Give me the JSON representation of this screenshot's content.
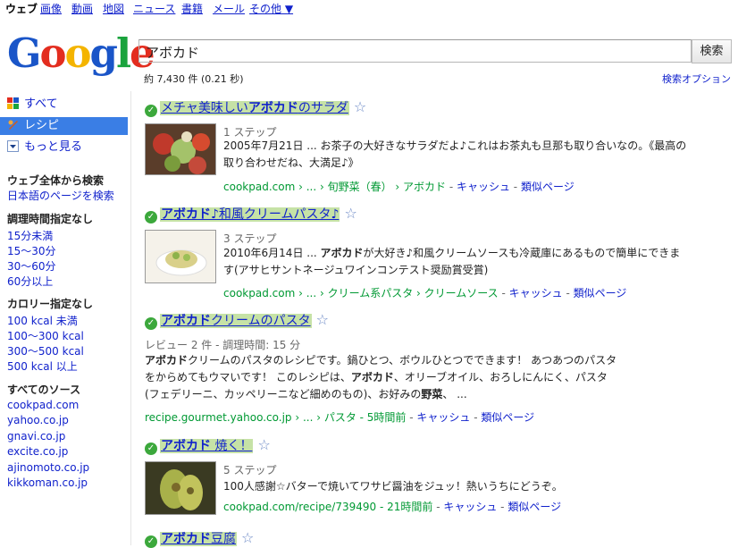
{
  "topnav": {
    "items": [
      "ウェブ",
      "画像",
      "動画",
      "地図",
      "ニュース",
      "書籍",
      "メール",
      "その他 ▼"
    ]
  },
  "logo": "Google",
  "search": {
    "query": "アボカド",
    "button": "検索"
  },
  "stats": "約 7,430 件 (0.21 秒)",
  "options_link": "検索オプション",
  "sidebar": {
    "modes": [
      "すべて",
      "レシピ",
      "もっと見る"
    ],
    "web_heading": "ウェブ全体から検索",
    "web_link": "日本語のページを検索",
    "time_heading": "調理時間指定なし",
    "time_links": [
      "15分未満",
      "15〜30分",
      "30〜60分",
      "60分以上"
    ],
    "cal_heading": "カロリー指定なし",
    "cal_links": [
      "100 kcal 未満",
      "100〜300 kcal",
      "300〜500 kcal",
      "500 kcal 以上"
    ],
    "src_heading": "すべてのソース",
    "src_links": [
      "cookpad.com",
      "yahoo.co.jp",
      "gnavi.co.jp",
      "excite.co.jp",
      "ajinomoto.co.jp",
      "kikkoman.co.jp"
    ]
  },
  "results": [
    {
      "title_pre": "メチャ美味しい",
      "title_b": "アボカド",
      "title_post": "のサラダ",
      "meta": "1 ステップ",
      "snippet_date": "2005年7月21日",
      "snippet": "... お茶子の大好きなサラダだよ♪これはお茶丸も旦那も取り合いなの。《最高の取り合わせだね、大満足♪》",
      "cite_host": "cookpad.com",
      "cite_path": " › ... › 旬野菜（春） › アボカド",
      "cache": "キャッシュ",
      "similar": "類似ページ"
    },
    {
      "title_pre": "",
      "title_b": "アボカド",
      "title_post": "♪和風クリームパスタ♪",
      "meta": "3 ステップ",
      "snippet_date": "2010年6月14日",
      "snippet_b": "アボカド",
      "snippet": "が大好き♪和風クリームソースも冷蔵庫にあるもので簡単にできます(アサヒサントネージュワインコンテスト奨励賞受賞)",
      "cite_host": "cookpad.com",
      "cite_path": " › ... › クリーム系パスタ › クリームソース",
      "cache": "キャッシュ",
      "similar": "類似ページ"
    },
    {
      "title_pre": "",
      "title_b": "アボカド",
      "title_post": "クリームのパスタ",
      "meta": "レビュー 2 件 - 調理時間: 15 分",
      "snippet_b": "アボカド",
      "snippet_1": "クリームのパスタのレシピです。鍋ひとつ、ボウルひとつでできます！ あつあつのパスタをからめてもウマいです！ このレシピは、",
      "snippet_b2": "アボカド",
      "snippet_2": "、オリーブオイル、おろしにんにく、パスタ(フェデリーニ、カッペリーニなど細めのもの)、お好みの",
      "snippet_b3": "野菜",
      "snippet_3": "、 ...",
      "cite_host": "recipe.gourmet.yahoo.co.jp",
      "cite_path": " › ... › パスタ - 5時間前",
      "cache": "キャッシュ",
      "similar": "類似ページ"
    },
    {
      "title_pre": "",
      "title_b": "アボカド",
      "title_post": " 焼く！",
      "meta": "5 ステップ",
      "snippet": "100人感謝☆バターで焼いてワサビ醤油をジュッ！熱いうちにどうぞ。",
      "cite_host": "cookpad.com/recipe/739490",
      "cite_path": " - 21時間前",
      "cache": "キャッシュ",
      "similar": "類似ページ"
    },
    {
      "title_pre": "",
      "title_b": "アボカド",
      "title_post": "豆腐"
    }
  ],
  "colors": {
    "link": "#1122cc",
    "cite": "#009933",
    "highlight": "#c6e2a6",
    "selected_mode": "#3a7ee5"
  }
}
